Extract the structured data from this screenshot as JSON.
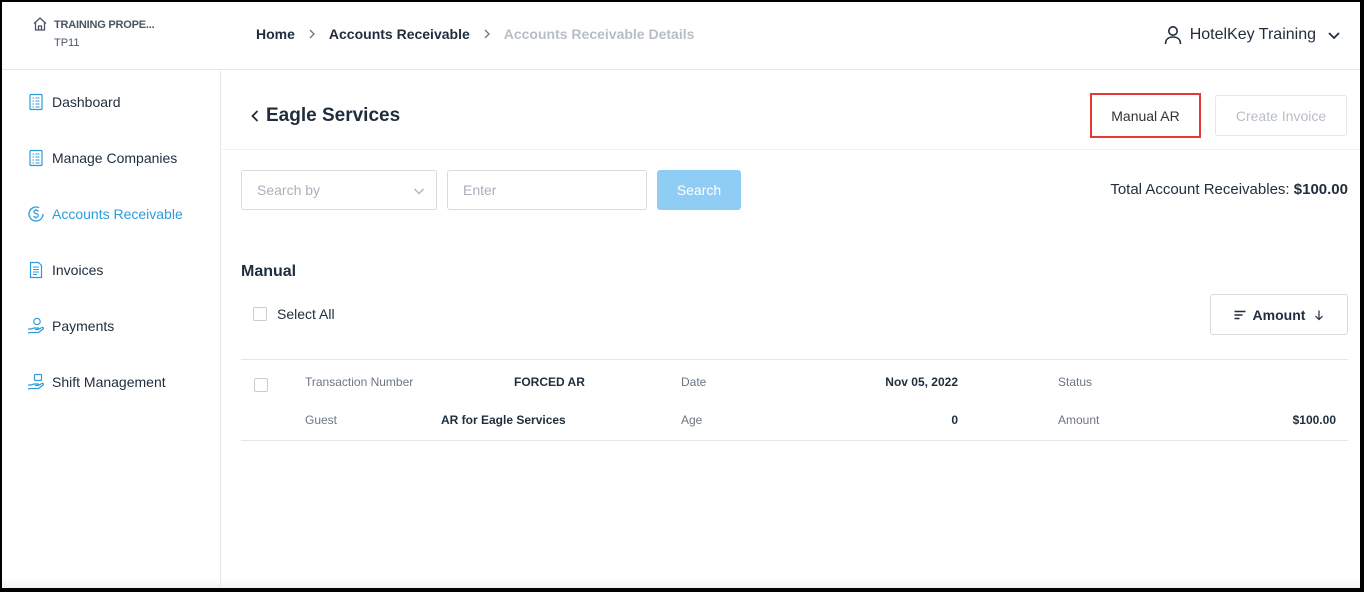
{
  "property": {
    "name": "TRAINING PROPE...",
    "code": "TP11",
    "icon": "home-icon"
  },
  "breadcrumb": {
    "home": "Home",
    "accounts_receivable": "Accounts Receivable",
    "current": "Accounts Receivable Details"
  },
  "user": {
    "name": "HotelKey Training",
    "icon": "user-icon"
  },
  "sidebar": {
    "items": [
      {
        "label": "Dashboard",
        "icon": "dashboard-icon"
      },
      {
        "label": "Manage Companies",
        "icon": "building-icon"
      },
      {
        "label": "Accounts Receivable",
        "icon": "dollar-circle-icon",
        "active": true
      },
      {
        "label": "Invoices",
        "icon": "invoice-icon"
      },
      {
        "label": "Payments",
        "icon": "payment-hand-icon"
      },
      {
        "label": "Shift Management",
        "icon": "shift-hand-icon"
      }
    ]
  },
  "header": {
    "title": "Eagle Services",
    "manual_ar": "Manual AR",
    "create_invoice": "Create Invoice"
  },
  "search": {
    "search_by_placeholder": "Search by",
    "input_placeholder": "Enter",
    "button": "Search"
  },
  "total": {
    "label": "Total Account Receivables:",
    "value": "$100.00"
  },
  "section": {
    "title": "Manual",
    "select_all": "Select All",
    "sort_label": "Amount"
  },
  "transaction": {
    "transaction_number_label": "Transaction Number",
    "transaction_number": "FORCED AR",
    "date_label": "Date",
    "date": "Nov 05, 2022",
    "status_label": "Status",
    "status": "",
    "guest_label": "Guest",
    "guest": "AR for Eagle Services",
    "age_label": "Age",
    "age": "0",
    "amount_label": "Amount",
    "amount": "$100.00"
  },
  "colors": {
    "accent": "#2d9cdb",
    "search_button": "#90cdf4",
    "highlight_border": "#e53935",
    "text": "#1f2d3d"
  }
}
